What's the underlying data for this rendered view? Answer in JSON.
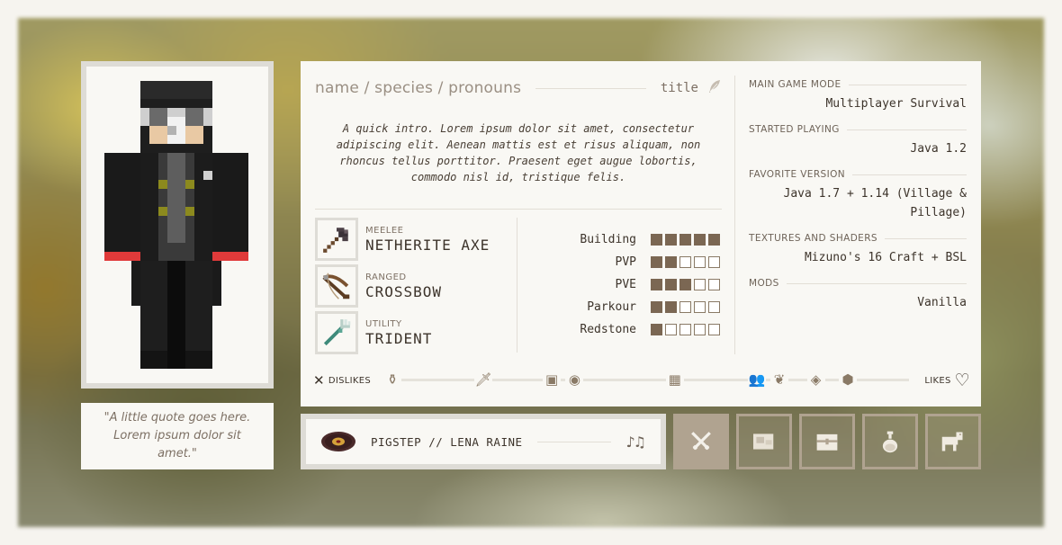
{
  "profile": {
    "name_line": "name / species / pronouns",
    "title": "title",
    "intro": "A quick intro. Lorem ipsum dolor sit amet, consectetur adipiscing elit. Aenean mattis est et risus aliquam, non rhoncus tellus porttitor. Praesent eget augue lobortis, commodo nisl id, tristique felis.",
    "quote": "\"A little quote goes here. Lorem ipsum dolor sit amet.\""
  },
  "weapons": [
    {
      "label": "MEELEE",
      "name": "NETHERITE AXE",
      "icon": "netherite-axe-icon"
    },
    {
      "label": "RANGED",
      "name": "CROSSBOW",
      "icon": "crossbow-icon"
    },
    {
      "label": "UTILITY",
      "name": "TRIDENT",
      "icon": "trident-icon"
    }
  ],
  "skills": [
    {
      "name": "Building",
      "level": 5,
      "max": 5
    },
    {
      "name": "PVP",
      "level": 2,
      "max": 5
    },
    {
      "name": "PVE",
      "level": 3,
      "max": 5
    },
    {
      "name": "Parkour",
      "level": 2,
      "max": 5
    },
    {
      "name": "Redstone",
      "level": 1,
      "max": 5
    }
  ],
  "stats": [
    {
      "label": "MAIN GAME MODE",
      "value": "Multiplayer Survival"
    },
    {
      "label": "STARTED PLAYING",
      "value": "Java 1.2"
    },
    {
      "label": "FAVORITE VERSION",
      "value": "Java 1.7 + 1.14 (Village & Pillage)"
    },
    {
      "label": "TEXTURES AND SHADERS",
      "value": "Mizuno's 16 Craft + BSL"
    },
    {
      "label": "MODS",
      "value": "Vanilla"
    }
  ],
  "likes_bar": {
    "dislikes_label": "DISLIKES",
    "likes_label": "LIKES",
    "items": [
      {
        "icon": "potion-icon",
        "position": 0.0
      },
      {
        "icon": "sword-icon",
        "position": 0.2
      },
      {
        "icon": "book-icon",
        "position": 0.35
      },
      {
        "icon": "compass-icon",
        "position": 0.4
      },
      {
        "icon": "chest-icon",
        "position": 0.62
      },
      {
        "icon": "villagers-icon",
        "position": 0.8
      },
      {
        "icon": "wheat-icon",
        "position": 0.85
      },
      {
        "icon": "diamond-icon",
        "position": 0.93
      },
      {
        "icon": "block-icon",
        "position": 1.0
      }
    ]
  },
  "music": {
    "song": "PIGSTEP // LENA RAINE",
    "disc_icon": "music-disc-icon",
    "notes_icon": "music-notes-icon"
  },
  "tabs": [
    {
      "icon": "crossed-swords-icon",
      "active": true
    },
    {
      "icon": "map-icon",
      "active": false
    },
    {
      "icon": "chest-icon",
      "active": false
    },
    {
      "icon": "potion-icon",
      "active": false
    },
    {
      "icon": "horse-icon",
      "active": false
    }
  ],
  "colors": {
    "accent": "#7b6753",
    "tab_border": "#b0a390",
    "panel": "#f9f8f4"
  }
}
